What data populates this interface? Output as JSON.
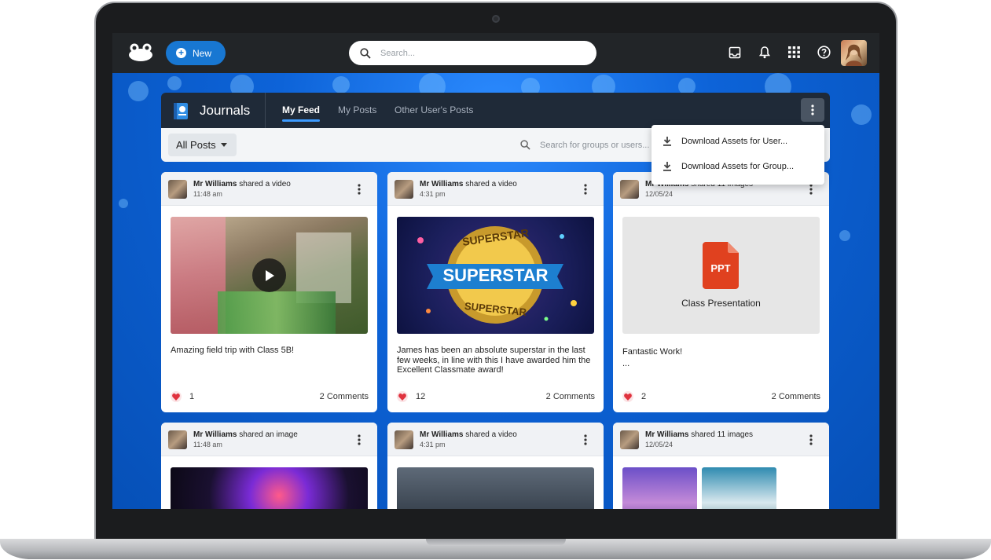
{
  "topbar": {
    "new_label": "New",
    "search_placeholder": "Search..."
  },
  "journals": {
    "title": "Journals",
    "tabs": [
      "My Feed",
      "My Posts",
      "Other User's Posts"
    ],
    "active_tab": "My Feed"
  },
  "filter": {
    "all_posts_label": "All Posts",
    "search_placeholder": "Search for groups or users..."
  },
  "menu": {
    "items": [
      "Download Assets for User...",
      "Download Assets for Group..."
    ]
  },
  "cards": [
    {
      "author": "Mr Williams",
      "action": "shared a video",
      "time": "11:48 am",
      "text": "Amazing field trip with Class 5B!",
      "likes": "1",
      "comments": "2 Comments"
    },
    {
      "author": "Mr Williams",
      "action": "shared a video",
      "time": "4:31 pm",
      "text": "James has been an absolute superstar in the last few weeks, in line with this I have awarded him the Excellent Classmate award!",
      "likes": "12",
      "comments": "2 Comments",
      "media_text_top": "SUPERSTAR",
      "media_text_mid": "SUPERSTAR",
      "media_text_bottom": "SUPERSTAR"
    },
    {
      "author": "Mr Williams",
      "action": "shared 11 images",
      "time": "12/05/24",
      "text": "Fantastic Work!",
      "text2": "...",
      "likes": "2",
      "comments": "2 Comments",
      "file_badge": "PPT",
      "file_name": "Class Presentation"
    },
    {
      "author": "Mr Williams",
      "action": "shared an image",
      "time": "11:48 am"
    },
    {
      "author": "Mr Williams",
      "action": "shared a video",
      "time": "4:31 pm"
    },
    {
      "author": "Mr Williams",
      "action": "shared 11 images",
      "time": "12/05/24"
    }
  ],
  "colors": {
    "accent": "#1877d2",
    "topbar": "#222528",
    "journal_bar": "#1f2a38",
    "heart": "#e0323e",
    "ppt": "#e0411f"
  }
}
